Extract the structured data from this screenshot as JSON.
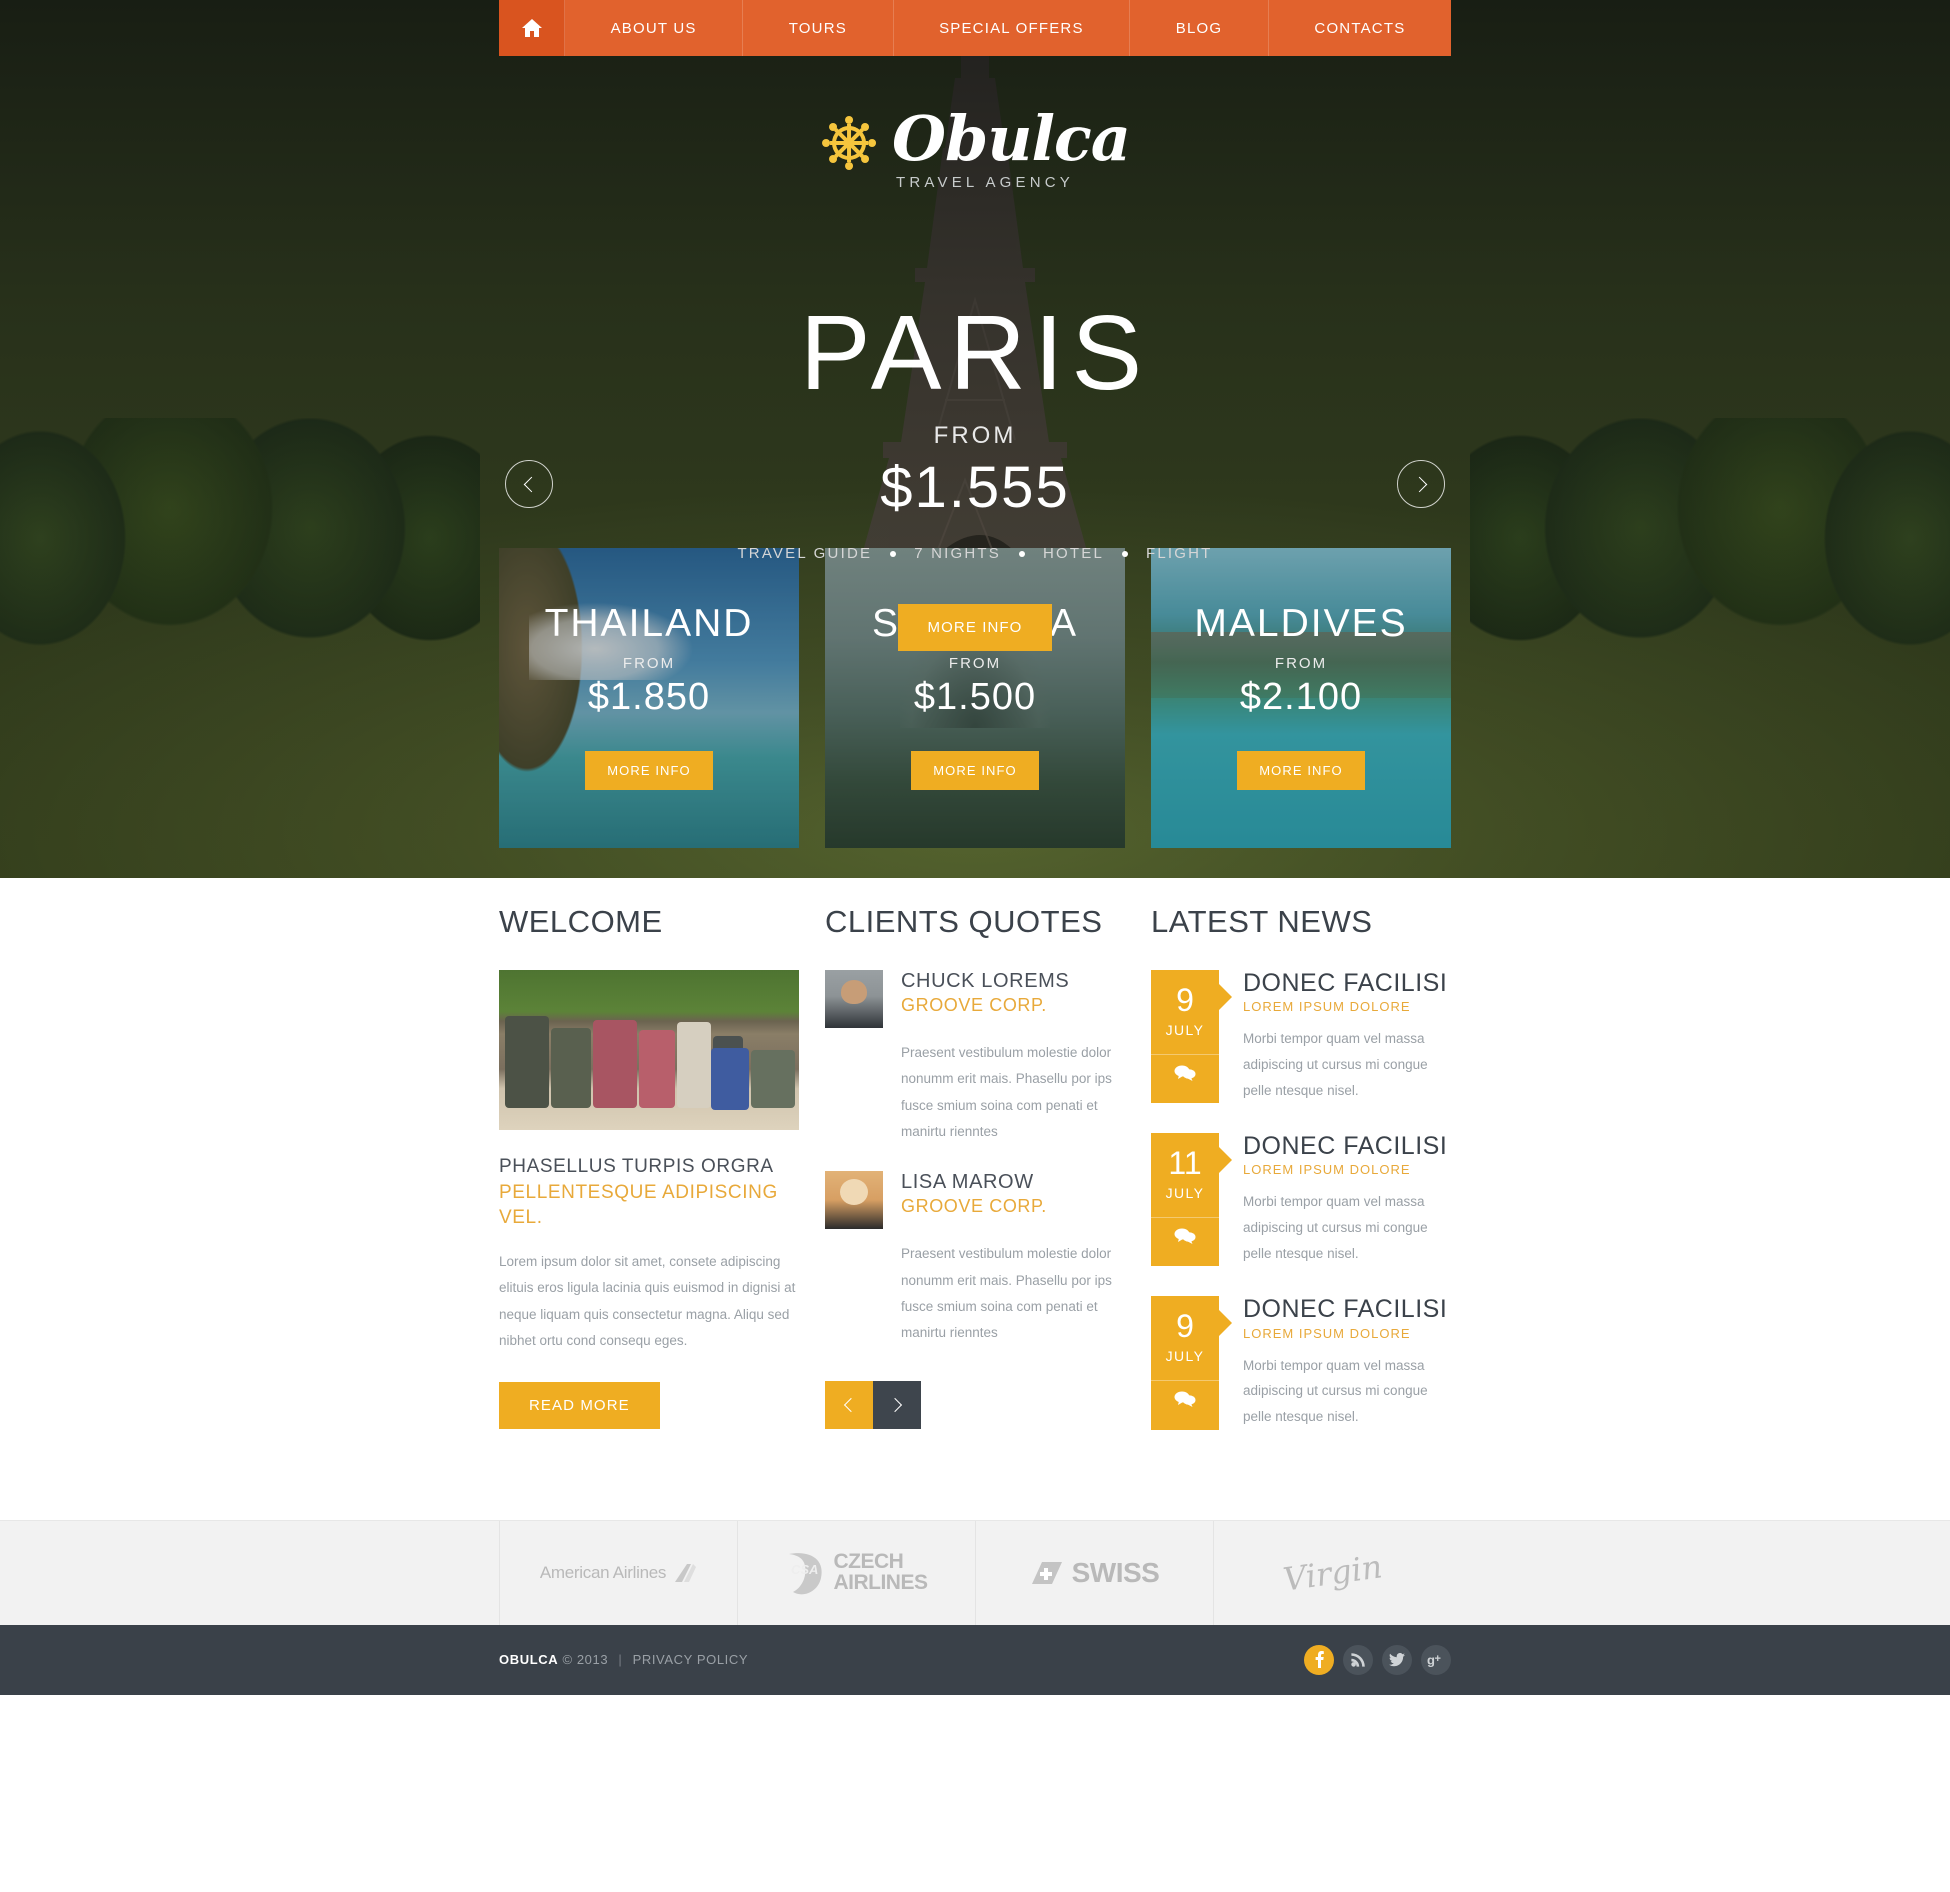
{
  "nav": {
    "home_icon": "home-icon",
    "items": [
      {
        "label": "ABOUT US"
      },
      {
        "label": "TOURS"
      },
      {
        "label": "SPECIAL OFFERS"
      },
      {
        "label": "BLOG"
      },
      {
        "label": "CONTACTS"
      }
    ]
  },
  "logo": {
    "icon": "ship-wheel-icon",
    "name": "Obulca",
    "tagline": "TRAVEL AGENCY",
    "accent_color": "#f5c councils"
  },
  "hero": {
    "city": "PARIS",
    "from_label": "FROM",
    "price": "$1.555",
    "features": [
      "TRAVEL GUIDE",
      "7 NIGHTS",
      "HOTEL",
      "FLIGHT"
    ],
    "cta_label": "MORE INFO",
    "prev_icon": "chevron-left-icon",
    "next_icon": "chevron-right-icon"
  },
  "cards": [
    {
      "title": "THAILAND",
      "from_label": "FROM",
      "price": "$1.850",
      "cta_label": "MORE INFO"
    },
    {
      "title": "SLOVAKIA",
      "from_label": "FROM",
      "price": "$1.500",
      "cta_label": "MORE INFO"
    },
    {
      "title": "MALDIVES",
      "from_label": "FROM",
      "price": "$2.100",
      "cta_label": "MORE INFO"
    }
  ],
  "welcome": {
    "heading": "WELCOME",
    "image_alt": "suitcases-photo",
    "subtitle_line1": "PHASELLUS TURPIS ORGRA",
    "subtitle_line2": "PELLENTESQUE ADIPISCING VEL.",
    "paragraph": "Lorem ipsum dolor sit amet, consete adipiscing elituis eros ligula lacinia quis euismod in dignisi at neque liquam quis consectetur magna. Aliqu sed nibhet ortu cond consequ eges.",
    "read_more_label": "READ MORE"
  },
  "quotes": {
    "heading": "CLIENTS QUOTES",
    "items": [
      {
        "name": "CHUCK LOREMS",
        "company": "GROOVE CORP.",
        "text": "Praesent vestibulum molestie dolor nonumm erit mais. Phasellu por ips fusce smium soina com penati et manirtu rienntes"
      },
      {
        "name": "LISA MAROW",
        "company": "GROOVE CORP.",
        "text": "Praesent vestibulum molestie dolor nonumm erit mais. Phasellu por ips fusce smium soina com penati et manirtu rienntes"
      }
    ],
    "prev_icon": "chevron-left-icon",
    "next_icon": "chevron-right-icon"
  },
  "news": {
    "heading": "LATEST NEWS",
    "items": [
      {
        "day": "9",
        "month": "JULY",
        "title": "DONEC FACILISI",
        "subtitle": "LOREM IPSUM DOLORE",
        "text": "Morbi tempor quam vel massa adipiscing ut cursus mi congue pelle ntesque nisel.",
        "comment_icon": "comments-icon"
      },
      {
        "day": "11",
        "month": "JULY",
        "title": "DONEC FACILISI",
        "subtitle": "LOREM IPSUM DOLORE",
        "text": "Morbi tempor quam vel massa adipiscing ut cursus mi congue pelle ntesque nisel.",
        "comment_icon": "comments-icon"
      },
      {
        "day": "9",
        "month": "JULY",
        "title": "DONEC FACILISI",
        "subtitle": "LOREM IPSUM DOLORE",
        "text": "Morbi tempor quam vel massa adipiscing ut cursus mi congue pelle ntesque nisel.",
        "comment_icon": "comments-icon"
      }
    ]
  },
  "partners": [
    {
      "name": "American Airlines",
      "icon": "american-airlines-logo"
    },
    {
      "name_line1": "CZECH",
      "name_line2": "AIRLINES",
      "badge": "CSA",
      "icon": "czech-airlines-logo"
    },
    {
      "name": "SWISS",
      "icon": "swiss-logo"
    },
    {
      "name": "Virgin",
      "icon": "virgin-logo"
    }
  ],
  "footer": {
    "brand": "OBULCA",
    "copyright": "© 2013",
    "separator": "|",
    "privacy_label": "PRIVACY POLICY",
    "socials": [
      {
        "name": "facebook-icon",
        "glyph": "f"
      },
      {
        "name": "rss-icon",
        "glyph": ""
      },
      {
        "name": "twitter-icon",
        "glyph": ""
      },
      {
        "name": "google-plus-icon",
        "glyph": "g+"
      }
    ]
  },
  "colors": {
    "nav_orange": "#e1622d",
    "amber": "#efad22",
    "dark_slate": "#3a4149",
    "text_gray": "#9aa0a6"
  }
}
